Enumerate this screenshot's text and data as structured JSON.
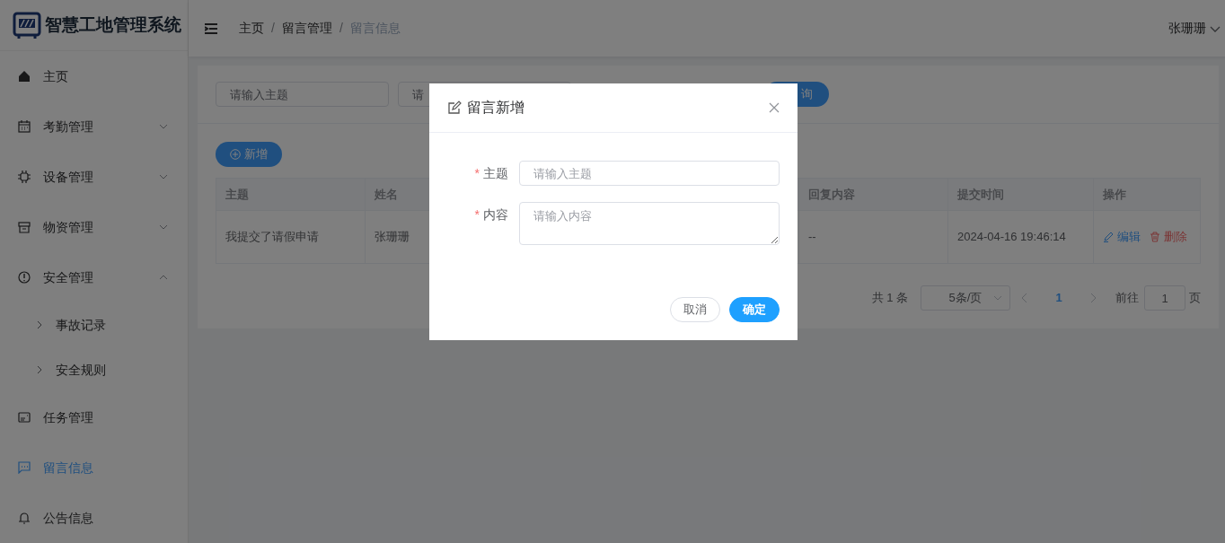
{
  "header": {
    "title": "智慧工地管理系统",
    "breadcrumb": [
      {
        "label": "主页",
        "selected": false
      },
      {
        "label": "留言管理",
        "selected": false
      },
      {
        "label": "留言信息",
        "selected": true
      }
    ],
    "separator": "/",
    "user": "张珊珊"
  },
  "sidebar": {
    "items": [
      {
        "label": "主页",
        "kind": "link",
        "selected": false
      },
      {
        "label": "考勤管理",
        "kind": "group",
        "selected": false,
        "expanded": false
      },
      {
        "label": "设备管理",
        "kind": "group",
        "selected": false,
        "expanded": false
      },
      {
        "label": "物资管理",
        "kind": "group",
        "selected": false,
        "expanded": false
      },
      {
        "label": "安全管理",
        "kind": "group",
        "selected": false,
        "expanded": true,
        "children": [
          {
            "label": "事故记录",
            "selected": false
          },
          {
            "label": "安全规则",
            "selected": false
          }
        ]
      },
      {
        "label": "任务管理",
        "kind": "link",
        "selected": false
      },
      {
        "label": "留言信息",
        "kind": "link",
        "selected": true
      },
      {
        "label": "公告信息",
        "kind": "link",
        "selected": false
      }
    ]
  },
  "search": {
    "fields": [
      {
        "placeholder": "请输入主题"
      },
      {
        "placeholder": "请"
      }
    ],
    "button": "询"
  },
  "toolbar": {
    "add_button": "新增"
  },
  "table": {
    "columns": [
      "主题",
      "姓名",
      "回复内容",
      "提交时间",
      "操作"
    ],
    "rows": [
      {
        "cells": [
          "我提交了请假申请",
          "张珊珊",
          "--",
          "2024-04-16 19:46:14"
        ],
        "actions": [
          "编辑",
          "删除"
        ]
      }
    ]
  },
  "pagination": {
    "total": "共 1 条",
    "page_size": "5条/页",
    "pages": [
      {
        "label": "1",
        "selected": true
      }
    ],
    "goto_label": "前往",
    "goto_value": "1",
    "goto_suffix": "页"
  },
  "dialog": {
    "title": "留言新增",
    "required_mark": "*",
    "fields": [
      {
        "label": "主题",
        "required": true,
        "kind": "input",
        "placeholder": "请输入主题"
      },
      {
        "label": "内容",
        "required": true,
        "kind": "textarea",
        "placeholder": "请输入内容"
      }
    ],
    "buttons": [
      {
        "label": "取消",
        "kind": "secondary"
      },
      {
        "label": "确定",
        "kind": "primary"
      }
    ]
  }
}
